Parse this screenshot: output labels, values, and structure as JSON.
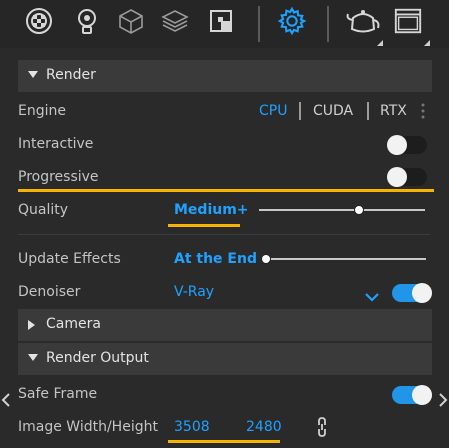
{
  "toolbar": {
    "icons": [
      "asset-library-icon",
      "lightbulb-icon",
      "cube-icon",
      "layers-icon",
      "texture-icon",
      "settings-icon",
      "teapot-icon",
      "frame-buffer-icon"
    ]
  },
  "render": {
    "title": "Render",
    "engine_label": "Engine",
    "engines": [
      "CPU",
      "CUDA",
      "RTX"
    ],
    "active_engine": "CPU",
    "interactive_label": "Interactive",
    "interactive_on": false,
    "progressive_label": "Progressive",
    "progressive_on": false,
    "quality_label": "Quality",
    "quality_value": "Medium+",
    "quality_level": 0.6,
    "update_effects_label": "Update Effects",
    "update_effects_value": "At the End",
    "update_effects_level": 0.0,
    "denoiser_label": "Denoiser",
    "denoiser_value": "V-Ray",
    "denoiser_on": true
  },
  "camera": {
    "title": "Camera"
  },
  "render_output": {
    "title": "Render Output",
    "safe_frame_label": "Safe Frame",
    "safe_frame_on": true,
    "image_wh_label": "Image Width/Height",
    "width": "3508",
    "height": "2480"
  },
  "colors": {
    "accent": "#1fa2ff",
    "highlight": "#f6b400",
    "toggle_on": "#2196e8"
  }
}
